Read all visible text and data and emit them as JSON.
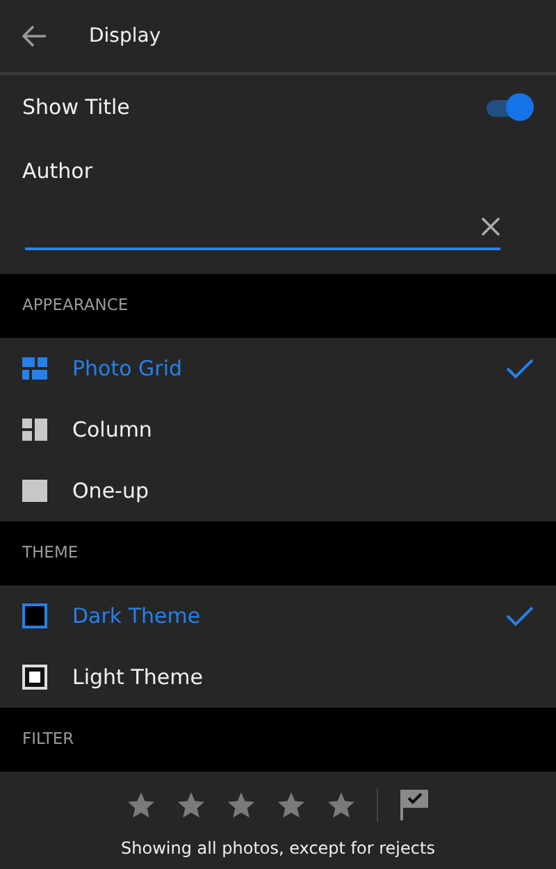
{
  "header": {
    "title": "Display"
  },
  "show_title": {
    "label": "Show Title",
    "on": true
  },
  "author": {
    "label": "Author"
  },
  "sections": [
    {
      "title": "APPEARANCE",
      "items": [
        {
          "label": "Photo Grid",
          "kind": "grid",
          "selected": true
        },
        {
          "label": "Column",
          "kind": "column",
          "selected": false
        },
        {
          "label": "One-up",
          "kind": "oneup",
          "selected": false
        }
      ]
    },
    {
      "title": "THEME",
      "items": [
        {
          "label": "Dark Theme",
          "kind": "dark",
          "selected": true
        },
        {
          "label": "Light Theme",
          "kind": "light",
          "selected": false
        }
      ]
    }
  ],
  "filter": {
    "title": "FILTER",
    "stars": 0,
    "caption": "Showing all photos, except for rejects"
  }
}
